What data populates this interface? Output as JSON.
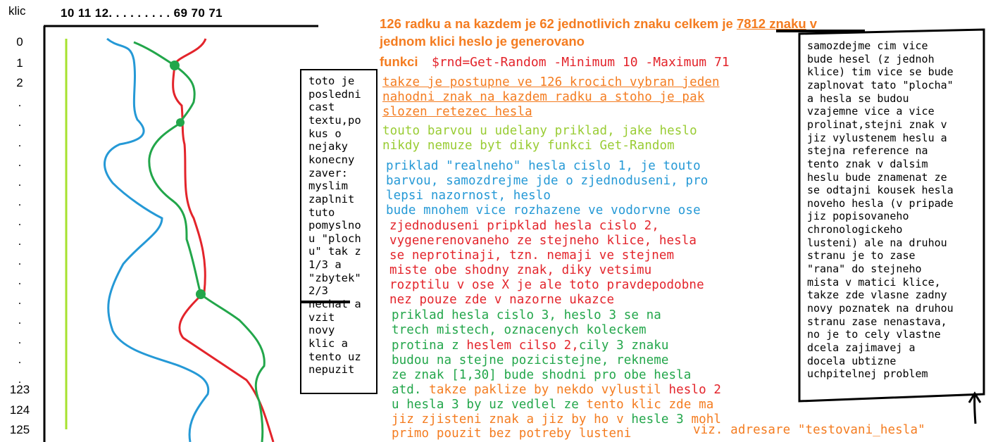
{
  "axis": {
    "klic_label": "klic",
    "columns": "10 11 12. . . . . . . . . 69 70 71",
    "rows": [
      "0",
      "1",
      "2",
      ".",
      ".",
      ".",
      ".",
      ".",
      ".",
      ".",
      ".",
      ".",
      ".",
      ".",
      ".",
      ".",
      ".",
      ".",
      "123",
      "124",
      "125"
    ]
  },
  "header": {
    "line1_pre": "126 radku a na kazdem je 62 jednotlivich znaku celkem je ",
    "line1_num": "7812 znaku",
    "line1_post": " v",
    "line2": "jednom klici heslo je generovano",
    "line3_label": "funkci",
    "line3_code": "$rnd=Get-Random -Minimum 10 -Maximum 71"
  },
  "left_note": [
    "toto je",
    "posledni",
    "cast",
    "textu,po",
    "kus o",
    "nejaky",
    "konecny",
    "zaver:",
    "myslim",
    "zaplnit",
    "tuto",
    "pomyslno",
    "u \"ploch",
    "u\" tak z",
    "1/3 a",
    "\"zbytek\"",
    "2/3",
    "nechat a",
    "vzit",
    "novy",
    "klic a",
    "tento uz",
    "nepuzit"
  ],
  "orange_block": [
    "takze je postupne ve 126 krocich vybran jeden",
    "nahodni znak na kazdem radku a stoho je pak",
    "slozen retezec hesla"
  ],
  "lime_block": [
    "touto barvou u udelany priklad, jake heslo",
    "nikdy nemuze byt diky funkci Get-Random"
  ],
  "blue_block": [
    "priklad \"realneho\" hesla cislo 1, je touto",
    "barvou, samozdrejme jde o zjednoduseni, pro",
    "lepsi nazornost, heslo",
    "bude mnohem vice rozhazene ve vodorvne ose"
  ],
  "red_block": [
    "zjednoduseni pripklad hesla cislo 2,",
    "vygenerenovaneho ze stejneho klice, hesla",
    "se neprotinaji, tzn. nemaji ve stejnem",
    "miste obe shodny znak, diky vetsimu",
    "rozptilu v ose X je ale toto pravdepodobne",
    "nez pouze zde v nazorne ukazce"
  ],
  "green_block": {
    "l1": "priklad hesla cislo 3, heslo 3 se na",
    "l2": "trech mistech, oznacenych koleckem",
    "l3a": "protina z ",
    "l3b": "heslem cilso 2,",
    "l3c": "cily 3 znaku",
    "l4": "budou na stejne pozicistejne, rekneme",
    "l5": "ze znak [1,30] bude shodni pro obe hesla",
    "l6a": "atd.",
    "l6b": " takze paklize by nekdo vylustil ",
    "l6c": "heslo 2",
    "l7a": "u hesla 3 by uz vedlel ze ",
    "l7b": "tento klic zde ma",
    "l8a": "jiz zjisteni znak a jiz by ho v ",
    "l8b": "hesle 3",
    "l8c": " mohl",
    "l9": "primo pouzit bez potreby lusteni",
    "footer": "viz. adresare \"testovani_hesla\""
  },
  "right_note": [
    "samozdejme cim vice",
    "bude hesel (z jednoh",
    "klice) tim vice se bude",
    "zaplnovat tato \"plocha\"",
    "a hesla se budou",
    "vzajemne vice a vice",
    "prolinat,stejni znak v",
    "jiz vylustenem heslu a",
    "stejna reference na",
    "tento znak v dalsim",
    "heslu bude znamenat ze",
    "se odtajni kousek hesla",
    "noveho hesla (v pripade",
    "jiz popisovaneho",
    "chronologickeho",
    "lusteni) ale na druhou",
    "stranu je to zase",
    "\"rana\" do stejneho",
    "mista v matici klice,",
    "takze zde vlasne zadny",
    "novy poznatek na druhou",
    "stranu zase nenastava,",
    "no je to cely vlastne",
    "dcela zajimavej a",
    "docela ubtizne",
    "uchpitelnej problem"
  ],
  "colors": {
    "orange": "#f47c20",
    "lime": "#99cc33",
    "blue": "#2599d6",
    "red": "#e3242b",
    "green": "#22a64a"
  }
}
